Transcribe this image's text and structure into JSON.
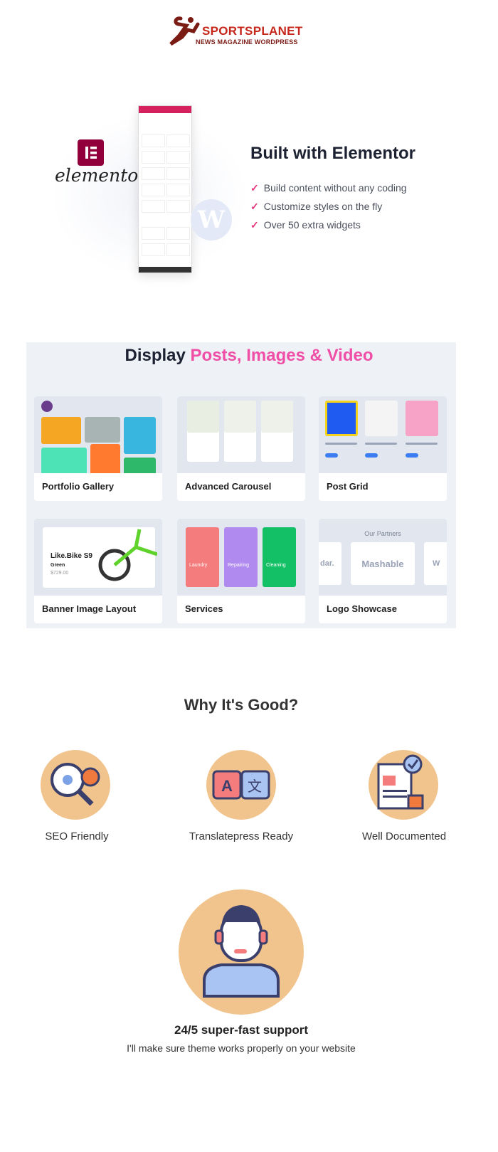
{
  "logo": {
    "name": "SPORTSPLANET",
    "tagline": "NEWS MAGAZINE WORDPRESS"
  },
  "elementor": {
    "brand": "elementor",
    "title": "Built with Elementor",
    "features": [
      "Build content without any coding",
      "Customize styles on the fly",
      "Over 50 extra widgets"
    ],
    "check_color": "#e4347b"
  },
  "display": {
    "title_prefix": "Display",
    "title_highlight": "Posts, Images & Video",
    "highlight_color": "#ef4fa6",
    "cards": [
      {
        "label": "Portfolio Gallery"
      },
      {
        "label": "Advanced Carousel"
      },
      {
        "label": "Post Grid"
      },
      {
        "label": "Banner Image Layout",
        "product": "Like.Bike S9",
        "variant": "Green",
        "price": "$729.00"
      },
      {
        "label": "Services",
        "items": [
          "Laundry",
          "Repairing",
          "Cleaning"
        ]
      },
      {
        "label": "Logo Showcase",
        "heading": "Our Partners",
        "logos": [
          "dar.",
          "Mashable",
          "W"
        ]
      }
    ]
  },
  "why": {
    "title": "Why It's Good?",
    "features": [
      {
        "label": "SEO Friendly",
        "icon": "seo-icon"
      },
      {
        "label": "Translatepress Ready",
        "icon": "translate-icon"
      },
      {
        "label": "Well Documented",
        "icon": "document-icon"
      }
    ],
    "accent": "#f2c48d"
  },
  "support": {
    "title": "24/5 super-fast support",
    "subtitle": "I'll make sure theme works properly on your website"
  }
}
